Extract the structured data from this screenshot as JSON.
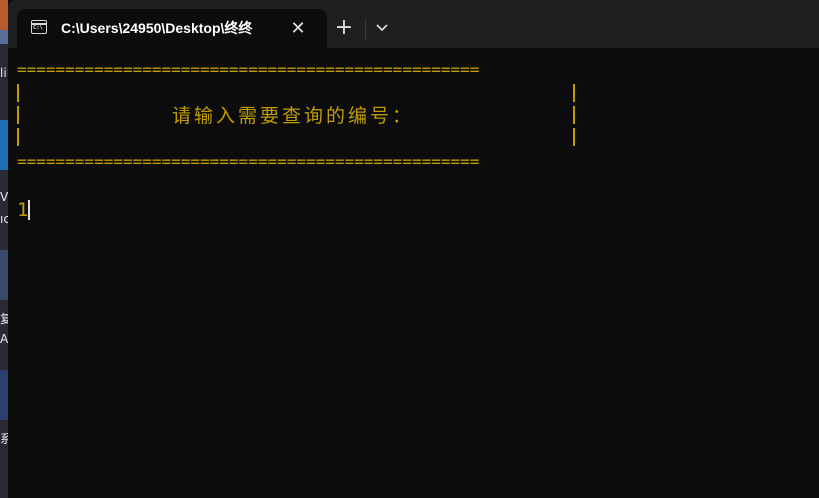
{
  "window": {
    "tab_title": "C:\\Users\\24950\\Desktop\\终终",
    "tab_icon_text": "C:\\",
    "close_label": "✕",
    "new_tab_label": "+"
  },
  "console": {
    "border_top": "================================================",
    "border_bottom": "================================================",
    "prompt": "请输入需要查询的编号：",
    "input_value": "1",
    "text_color": "#c19c00"
  },
  "desktop": {
    "peek_text": [
      "li",
      "V",
      "ıc",
      "复",
      "A",
      "系"
    ]
  }
}
